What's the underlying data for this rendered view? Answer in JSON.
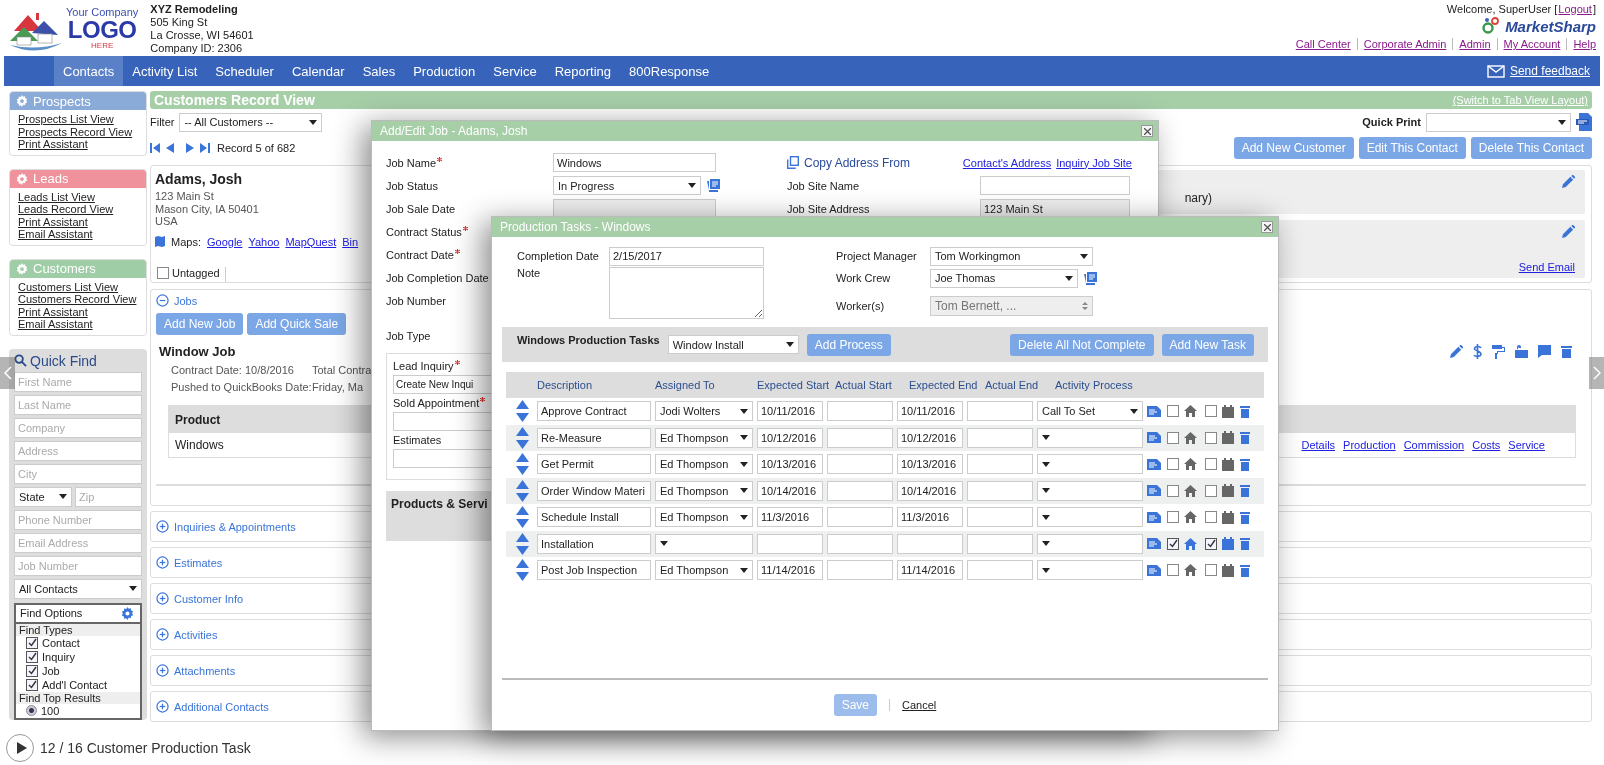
{
  "header": {
    "logo": {
      "top": "Your Company",
      "main": "LOGO",
      "sub": "HERE"
    },
    "company_lines": [
      "XYZ Remodeling",
      "505 King St",
      "La Crosse, WI 54601",
      "Company ID: 2306"
    ],
    "welcome": "Welcome, SuperUser [",
    "logout": "Logout",
    "welcome_end": "]",
    "brand": "MarketSharp",
    "links": [
      "Call Center",
      "Corporate Admin",
      "Admin",
      "My Account",
      "Help"
    ]
  },
  "nav": {
    "items": [
      {
        "label": "Contacts",
        "selected": true
      },
      {
        "label": "Activity List",
        "selected": false
      },
      {
        "label": "Scheduler",
        "selected": false
      },
      {
        "label": "Calendar",
        "selected": false
      },
      {
        "label": "Sales",
        "selected": false
      },
      {
        "label": "Production",
        "selected": false
      },
      {
        "label": "Service",
        "selected": false
      },
      {
        "label": "Reporting",
        "selected": false
      },
      {
        "label": "800Response",
        "selected": false
      }
    ],
    "feedback": "Send feedback"
  },
  "sidebar": {
    "sections": [
      {
        "title": "Prospects",
        "color": "#8aaad8",
        "links": [
          "Prospects List View",
          "Prospects Record View",
          "Print Assistant"
        ]
      },
      {
        "title": "Leads",
        "color": "#f0929b",
        "links": [
          "Leads List View",
          "Leads Record View",
          "Print Assistant",
          "Email Assistant"
        ]
      },
      {
        "title": "Customers",
        "color": "#9fcda5",
        "links": [
          "Customers List View",
          "Customers Record View",
          "Print Assistant",
          "Email Assistant"
        ]
      }
    ],
    "quick_find": {
      "title": "Quick Find",
      "fields": [
        {
          "placeholder": "First Name"
        },
        {
          "placeholder": "Last Name"
        },
        {
          "placeholder": "Company"
        },
        {
          "placeholder": "Address"
        },
        {
          "placeholder": "City"
        }
      ],
      "state": "State",
      "zip": {
        "placeholder": "Zip"
      },
      "fields_2": [
        {
          "placeholder": "Phone Number"
        },
        {
          "placeholder": "Email Address"
        },
        {
          "placeholder": "Job Number"
        }
      ],
      "contact_type": "All Contacts",
      "find_options": {
        "title": "Find Options",
        "types_title": "Find Types",
        "types": [
          {
            "label": "Contact",
            "checked": true
          },
          {
            "label": "Inquiry",
            "checked": true
          },
          {
            "label": "Job",
            "checked": true
          },
          {
            "label": "Add'l Contact",
            "checked": true
          }
        ],
        "results_title": "Find Top Results",
        "results": [
          {
            "label": "100",
            "selected": true
          }
        ]
      }
    }
  },
  "record_view": {
    "title": "Customers Record View",
    "switch_link": "(Switch to Tab View Layout)",
    "filter_label": "Filter",
    "filter_value": "-- All Customers --",
    "record": "Record 5 of 682",
    "quick_print": "Quick Print",
    "buttons": [
      "Add New Customer",
      "Edit This Contact",
      "Delete This Contact"
    ],
    "contact": {
      "name": "Adams, Josh",
      "address": [
        "123 Main St",
        "Mason City, IA 50401",
        "USA"
      ],
      "maps_label": "Maps:",
      "maps": [
        "Google",
        "Yahoo",
        "MapQuest",
        "Bin"
      ],
      "note_fragment": "nary)",
      "send_email": "Send Email",
      "tag": {
        "label": "Untagged",
        "checked": false
      }
    },
    "jobs": {
      "title": "Jobs",
      "expanded": true,
      "buttons": [
        "Add New Job",
        "Add Quick Sale"
      ],
      "job_title": "Window Job",
      "contract_date": "Contract Date: 10/8/2016",
      "total_fragment": "Total Contra",
      "pushed_label": "Pushed to QuickBooks Date:",
      "pushed_fragment": "Friday, Ma",
      "product_header": "Product",
      "product": "Windows",
      "links": [
        "Details",
        "Production",
        "Commission",
        "Costs",
        "Service"
      ]
    },
    "sections": [
      {
        "title": "Inquiries & Appointments",
        "expanded": false
      },
      {
        "title": "Estimates",
        "expanded": false
      },
      {
        "title": "Customer Info",
        "expanded": false
      },
      {
        "title": "Activities",
        "expanded": false
      },
      {
        "title": "Attachments",
        "expanded": false
      },
      {
        "title": "Additional Contacts",
        "expanded": false
      }
    ]
  },
  "job_dialog": {
    "title": "Add/Edit Job - Adams, Josh",
    "fields": [
      {
        "label": "Job Name",
        "required": true,
        "kind": "input",
        "value": "Windows"
      },
      {
        "label": "Job Status",
        "required": false,
        "kind": "select",
        "value": "In Progress"
      },
      {
        "label": "Job Sale Date",
        "required": false,
        "kind": "disabled"
      },
      {
        "label": "Contract Status",
        "required": true
      },
      {
        "label": "Contract Date",
        "required": true
      },
      {
        "label": "Job Completion Date"
      },
      {
        "label": "Job Number",
        "required": false
      },
      {
        "label": "Job Type",
        "required": false
      }
    ],
    "copy_address": "Copy Address From",
    "address_links": [
      "Contact's Address",
      "Inquiry Job Site"
    ],
    "site_fields": [
      {
        "label": "Job Site Name",
        "disabled": false
      },
      {
        "label": "Job Site Address",
        "value": "123 Main St",
        "disabled": true
      }
    ],
    "lead_label": "Lead Inquiry",
    "lead_value": "Create New Inqui",
    "sold_label": "Sold Appointment",
    "estimates_label": "Estimates",
    "products": "Products & Servi"
  },
  "production": {
    "title": "Production Tasks - Windows",
    "completion_label": "Completion Date",
    "completion_value": "2/15/2017",
    "note_label": "Note",
    "manager_label": "Project Manager",
    "manager": "Tom Workingmon",
    "crew_label": "Work Crew",
    "crew": "Joe Thomas",
    "workers_label": "Worker(s)",
    "workers": "Tom Bernett, ...",
    "toolbar_label": "Windows Production Tasks",
    "process": "Window Install",
    "add_process": "Add Process",
    "delete_all": "Delete All Not Complete",
    "add_task": "Add New Task",
    "columns": [
      "Description",
      "Assigned To",
      "Expected Start",
      "Actual Start",
      "Expected End",
      "Actual End",
      "Activity Process"
    ],
    "tasks": [
      {
        "description": "Approve Contract",
        "assigned": "Jodi Wolters",
        "expected_start": "10/11/2016",
        "expected_end": "10/11/2016",
        "activity": "Call To Set",
        "notified": false,
        "scheduled": false
      },
      {
        "description": "Re-Measure",
        "assigned": "Ed Thompson",
        "expected_start": "10/12/2016",
        "expected_end": "10/12/2016",
        "notified": false,
        "scheduled": false
      },
      {
        "description": "Get Permit",
        "assigned": "Ed Thompson",
        "expected_start": "10/13/2016",
        "expected_end": "10/13/2016",
        "notified": false,
        "scheduled": false
      },
      {
        "description": "Order Window Materi",
        "assigned": "Ed Thompson",
        "expected_start": "10/14/2016",
        "expected_end": "10/14/2016",
        "notified": false,
        "scheduled": false
      },
      {
        "description": "Schedule Install",
        "assigned": "Ed Thompson",
        "expected_start": "11/3/2016",
        "expected_end": "11/3/2016",
        "notified": false,
        "scheduled": false
      },
      {
        "description": "Installation",
        "notified": true,
        "scheduled": true
      },
      {
        "description": "Post Job Inspection",
        "assigned": "Ed Thompson",
        "expected_start": "11/14/2016",
        "expected_end": "11/14/2016",
        "notified": false,
        "scheduled": false
      }
    ],
    "save": {
      "label": "Save",
      "disabled": true
    },
    "cancel": "Cancel"
  },
  "player": {
    "caption": "12 / 16 Customer Production Task"
  }
}
